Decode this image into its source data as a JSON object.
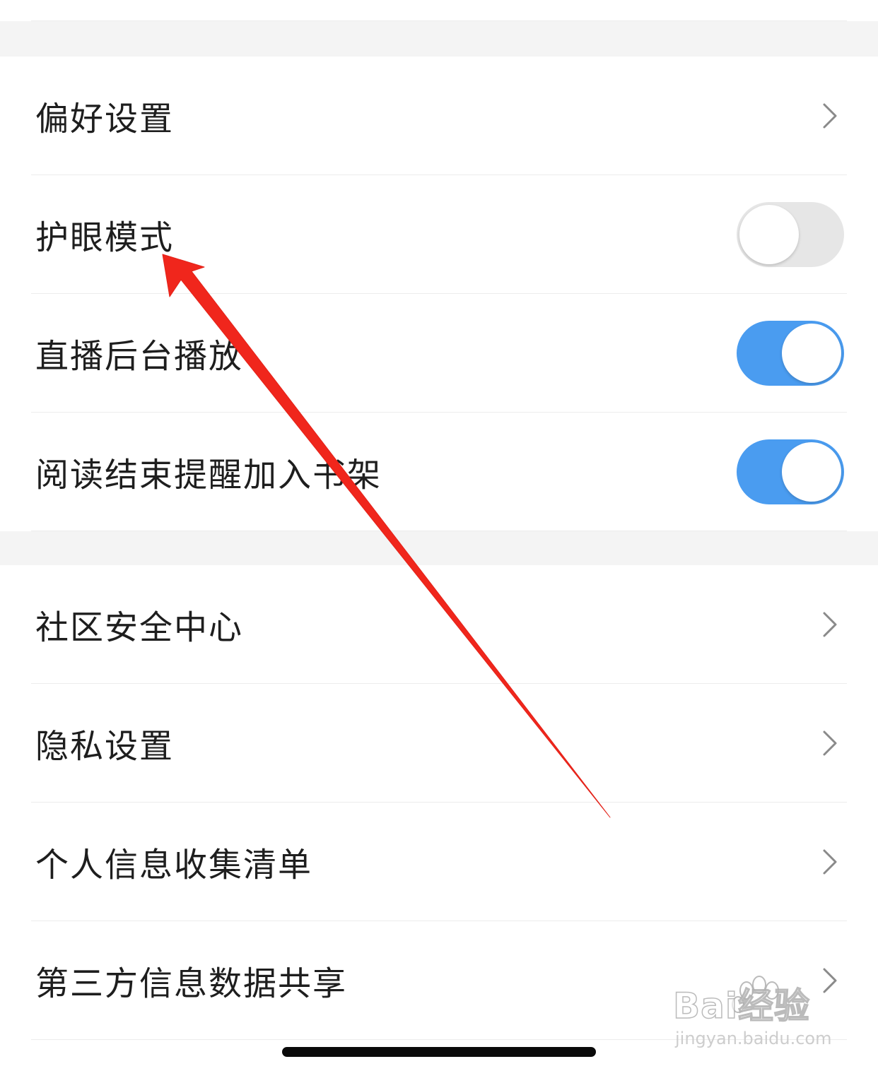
{
  "group_one": {
    "items": [
      {
        "label": "偏好设置",
        "control": "chevron"
      },
      {
        "label": "护眼模式",
        "control": "toggle",
        "on": false
      },
      {
        "label": "直播后台播放",
        "control": "toggle",
        "on": true
      },
      {
        "label": "阅读结束提醒加入书架",
        "control": "toggle",
        "on": true
      }
    ]
  },
  "group_two": {
    "items": [
      {
        "label": "社区安全中心",
        "control": "chevron"
      },
      {
        "label": "隐私设置",
        "control": "chevron"
      },
      {
        "label": "个人信息收集清单",
        "control": "chevron"
      },
      {
        "label": "第三方信息数据共享",
        "control": "chevron"
      }
    ]
  },
  "watermark": {
    "brand": "Bai经验",
    "url": "jingyan.baidu.com"
  },
  "colors": {
    "toggle_on": "#4a9cf0",
    "toggle_off": "#e6e6e6",
    "annotation_arrow": "#f0261c",
    "section_gap": "#f4f4f4"
  },
  "icons": {
    "chevron": "chevron-right-icon",
    "paw": "baidu-paw-icon"
  }
}
